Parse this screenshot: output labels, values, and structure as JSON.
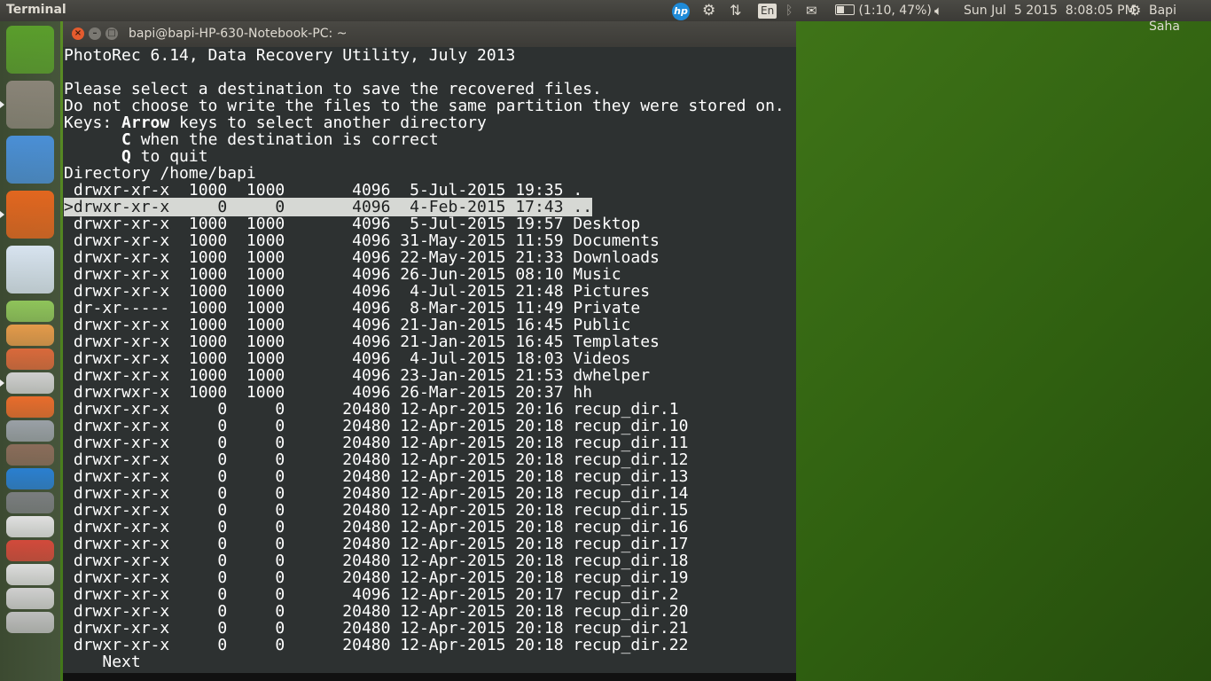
{
  "panel": {
    "app_name": "Terminal",
    "keyboard_layout": "En",
    "battery": "(1:10, 47%)",
    "datetime": "Sun Jul  5 2015  8:08:05 PM",
    "user": "Bapi Saha",
    "hp_label": "hp"
  },
  "window": {
    "title": "bapi@bapi-HP-630-Notebook-PC: ~"
  },
  "terminal": {
    "header": "PhotoRec 6.14, Data Recovery Utility, July 2013",
    "instruction_1": "Please select a destination to save the recovered files.",
    "instruction_2": "Do not choose to write the files to the same partition they were stored on.",
    "keys_label": "Keys: ",
    "key_arrow": "Arrow",
    "key_arrow_desc": " keys to select another directory",
    "key_c": "C",
    "key_c_desc": " when the destination is correct",
    "key_q": "Q",
    "key_q_desc": " to quit",
    "directory": "Directory /home/bapi",
    "selected_marker": ">",
    "entries": [
      {
        "perm": "drwxr-xr-x",
        "uid": "1000",
        "gid": "1000",
        "size": "4096",
        "date": "5-Jul-2015",
        "time": "19:35",
        "name": "."
      },
      {
        "perm": "drwxr-xr-x",
        "uid": "0",
        "gid": "0",
        "size": "4096",
        "date": "4-Feb-2015",
        "time": "17:43",
        "name": ".."
      },
      {
        "perm": "drwxr-xr-x",
        "uid": "1000",
        "gid": "1000",
        "size": "4096",
        "date": "5-Jul-2015",
        "time": "19:57",
        "name": "Desktop"
      },
      {
        "perm": "drwxr-xr-x",
        "uid": "1000",
        "gid": "1000",
        "size": "4096",
        "date": "31-May-2015",
        "time": "11:59",
        "name": "Documents"
      },
      {
        "perm": "drwxr-xr-x",
        "uid": "1000",
        "gid": "1000",
        "size": "4096",
        "date": "22-May-2015",
        "time": "21:33",
        "name": "Downloads"
      },
      {
        "perm": "drwxr-xr-x",
        "uid": "1000",
        "gid": "1000",
        "size": "4096",
        "date": "26-Jun-2015",
        "time": "08:10",
        "name": "Music"
      },
      {
        "perm": "drwxr-xr-x",
        "uid": "1000",
        "gid": "1000",
        "size": "4096",
        "date": "4-Jul-2015",
        "time": "21:48",
        "name": "Pictures"
      },
      {
        "perm": "dr-xr-----",
        "uid": "1000",
        "gid": "1000",
        "size": "4096",
        "date": "8-Mar-2015",
        "time": "11:49",
        "name": "Private"
      },
      {
        "perm": "drwxr-xr-x",
        "uid": "1000",
        "gid": "1000",
        "size": "4096",
        "date": "21-Jan-2015",
        "time": "16:45",
        "name": "Public"
      },
      {
        "perm": "drwxr-xr-x",
        "uid": "1000",
        "gid": "1000",
        "size": "4096",
        "date": "21-Jan-2015",
        "time": "16:45",
        "name": "Templates"
      },
      {
        "perm": "drwxr-xr-x",
        "uid": "1000",
        "gid": "1000",
        "size": "4096",
        "date": "4-Jul-2015",
        "time": "18:03",
        "name": "Videos"
      },
      {
        "perm": "drwxr-xr-x",
        "uid": "1000",
        "gid": "1000",
        "size": "4096",
        "date": "23-Jan-2015",
        "time": "21:53",
        "name": "dwhelper"
      },
      {
        "perm": "drwxrwxr-x",
        "uid": "1000",
        "gid": "1000",
        "size": "4096",
        "date": "26-Mar-2015",
        "time": "20:37",
        "name": "hh"
      },
      {
        "perm": "drwxr-xr-x",
        "uid": "0",
        "gid": "0",
        "size": "20480",
        "date": "12-Apr-2015",
        "time": "20:16",
        "name": "recup_dir.1"
      },
      {
        "perm": "drwxr-xr-x",
        "uid": "0",
        "gid": "0",
        "size": "20480",
        "date": "12-Apr-2015",
        "time": "20:18",
        "name": "recup_dir.10"
      },
      {
        "perm": "drwxr-xr-x",
        "uid": "0",
        "gid": "0",
        "size": "20480",
        "date": "12-Apr-2015",
        "time": "20:18",
        "name": "recup_dir.11"
      },
      {
        "perm": "drwxr-xr-x",
        "uid": "0",
        "gid": "0",
        "size": "20480",
        "date": "12-Apr-2015",
        "time": "20:18",
        "name": "recup_dir.12"
      },
      {
        "perm": "drwxr-xr-x",
        "uid": "0",
        "gid": "0",
        "size": "20480",
        "date": "12-Apr-2015",
        "time": "20:18",
        "name": "recup_dir.13"
      },
      {
        "perm": "drwxr-xr-x",
        "uid": "0",
        "gid": "0",
        "size": "20480",
        "date": "12-Apr-2015",
        "time": "20:18",
        "name": "recup_dir.14"
      },
      {
        "perm": "drwxr-xr-x",
        "uid": "0",
        "gid": "0",
        "size": "20480",
        "date": "12-Apr-2015",
        "time": "20:18",
        "name": "recup_dir.15"
      },
      {
        "perm": "drwxr-xr-x",
        "uid": "0",
        "gid": "0",
        "size": "20480",
        "date": "12-Apr-2015",
        "time": "20:18",
        "name": "recup_dir.16"
      },
      {
        "perm": "drwxr-xr-x",
        "uid": "0",
        "gid": "0",
        "size": "20480",
        "date": "12-Apr-2015",
        "time": "20:18",
        "name": "recup_dir.17"
      },
      {
        "perm": "drwxr-xr-x",
        "uid": "0",
        "gid": "0",
        "size": "20480",
        "date": "12-Apr-2015",
        "time": "20:18",
        "name": "recup_dir.18"
      },
      {
        "perm": "drwxr-xr-x",
        "uid": "0",
        "gid": "0",
        "size": "20480",
        "date": "12-Apr-2015",
        "time": "20:18",
        "name": "recup_dir.19"
      },
      {
        "perm": "drwxr-xr-x",
        "uid": "0",
        "gid": "0",
        "size": "4096",
        "date": "12-Apr-2015",
        "time": "20:17",
        "name": "recup_dir.2"
      },
      {
        "perm": "drwxr-xr-x",
        "uid": "0",
        "gid": "0",
        "size": "20480",
        "date": "12-Apr-2015",
        "time": "20:18",
        "name": "recup_dir.20"
      },
      {
        "perm": "drwxr-xr-x",
        "uid": "0",
        "gid": "0",
        "size": "20480",
        "date": "12-Apr-2015",
        "time": "20:18",
        "name": "recup_dir.21"
      },
      {
        "perm": "drwxr-xr-x",
        "uid": "0",
        "gid": "0",
        "size": "20480",
        "date": "12-Apr-2015",
        "time": "20:18",
        "name": "recup_dir.22"
      }
    ],
    "next_label": "Next"
  },
  "launcher_items": [
    {
      "name": "ubuntu-dash-icon",
      "color": "#5a9e2c"
    },
    {
      "name": "files-icon",
      "color": "#8a8478"
    },
    {
      "name": "chromium-icon",
      "color": "#4a8fd6"
    },
    {
      "name": "firefox-icon",
      "color": "#e2661f"
    },
    {
      "name": "libreoffice-writer-icon",
      "color": "#d7e3ef"
    },
    {
      "name": "libreoffice-calc-icon",
      "color": "#8fc45a"
    },
    {
      "name": "libreoffice-impress-icon",
      "color": "#e49a4a"
    },
    {
      "name": "draw-icon",
      "color": "#d9693b"
    },
    {
      "name": "scanner-icon",
      "color": "#cfcfcf"
    },
    {
      "name": "software-center-icon",
      "color": "#e86c2c"
    },
    {
      "name": "calculator-icon",
      "color": "#9aa0a6"
    },
    {
      "name": "gimp-icon",
      "color": "#8a6c5a"
    },
    {
      "name": "video-editor-icon",
      "color": "#2a7fd0"
    },
    {
      "name": "config-icon",
      "color": "#7a7d7f"
    },
    {
      "name": "text-editor-icon",
      "color": "#e0e0e0"
    },
    {
      "name": "media-player-icon",
      "color": "#d24a3b"
    },
    {
      "name": "disk-icon",
      "color": "#dcdcdc"
    },
    {
      "name": "workspace-icon",
      "color": "#cfcfcf"
    },
    {
      "name": "trash-icon",
      "color": "#bdbdbd"
    }
  ]
}
